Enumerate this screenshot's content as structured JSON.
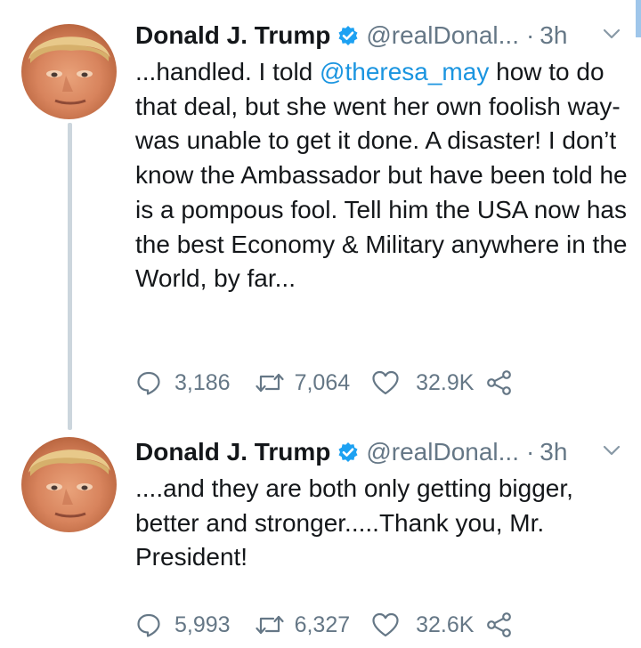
{
  "tweets": [
    {
      "name": "Donald J. Trump",
      "handle": "@realDonal...",
      "dot": "·",
      "time": "3h",
      "text_before_mention": "...handled. I told ",
      "mention": "@theresa_may",
      "text_after_mention": " how to do that deal, but she went her own foolish way-was unable to get it done. A disaster! I don’t know the Ambassador but have been told he is a pompous fool. Tell him the USA now has the best Economy & Military  anywhere in the World, by far...",
      "replies": "3,186",
      "retweets": "7,064",
      "likes": "32.9K"
    },
    {
      "name": "Donald J. Trump",
      "handle": "@realDonal...",
      "dot": "·",
      "time": "3h",
      "text": "....and they are both only getting bigger, better and stronger.....Thank you, Mr. President!",
      "replies": "5,993",
      "retweets": "6,327",
      "likes": "32.6K"
    }
  ],
  "icons": {
    "verified": "verified-badge-icon",
    "menu": "chevron-down-icon",
    "reply": "reply-icon",
    "retweet": "retweet-icon",
    "like": "heart-icon",
    "share": "share-icon"
  },
  "colors": {
    "text": "#14171a",
    "secondary": "#657786",
    "mention": "#1b95e0",
    "verified": "#1da1f2",
    "thread_line": "#ccd6dd"
  }
}
